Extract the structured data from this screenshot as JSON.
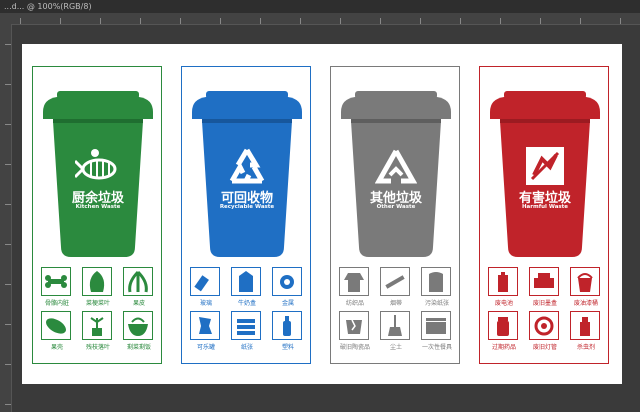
{
  "window": {
    "title": "...d... @ 100%(RGB/8)"
  },
  "colors": {
    "green": "#2b8a3e",
    "blue": "#1f6fc4",
    "gray": "#7a7a7a",
    "red": "#c0232a"
  },
  "panels": [
    {
      "name_cn": "厨余垃圾",
      "name_en": "Kitchen Waste",
      "icon": "fish-bone-icon",
      "items": [
        "骨骼内脏",
        "菜梗菜叶",
        "果皮",
        "果壳",
        "残枝落叶",
        "剩菜剩饭"
      ]
    },
    {
      "name_cn": "可回收物",
      "name_en": "Recyclable Waste",
      "icon": "recycle-icon",
      "items": [
        "玻璃",
        "牛奶盒",
        "金属",
        "可乐罐",
        "纸张",
        "塑料"
      ]
    },
    {
      "name_cn": "其他垃圾",
      "name_en": "Other Waste",
      "icon": "triangle-arrow-icon",
      "items": [
        "纺织品",
        "烟蒂",
        "污染纸张",
        "破旧陶瓷品",
        "尘土",
        "一次性餐具"
      ]
    },
    {
      "name_cn": "有害垃圾",
      "name_en": "Harmful Waste",
      "icon": "harmful-icon",
      "items": [
        "废电池",
        "废旧墨盒",
        "废油漆桶",
        "过期药品",
        "废旧灯管",
        "杀虫剂"
      ]
    }
  ]
}
